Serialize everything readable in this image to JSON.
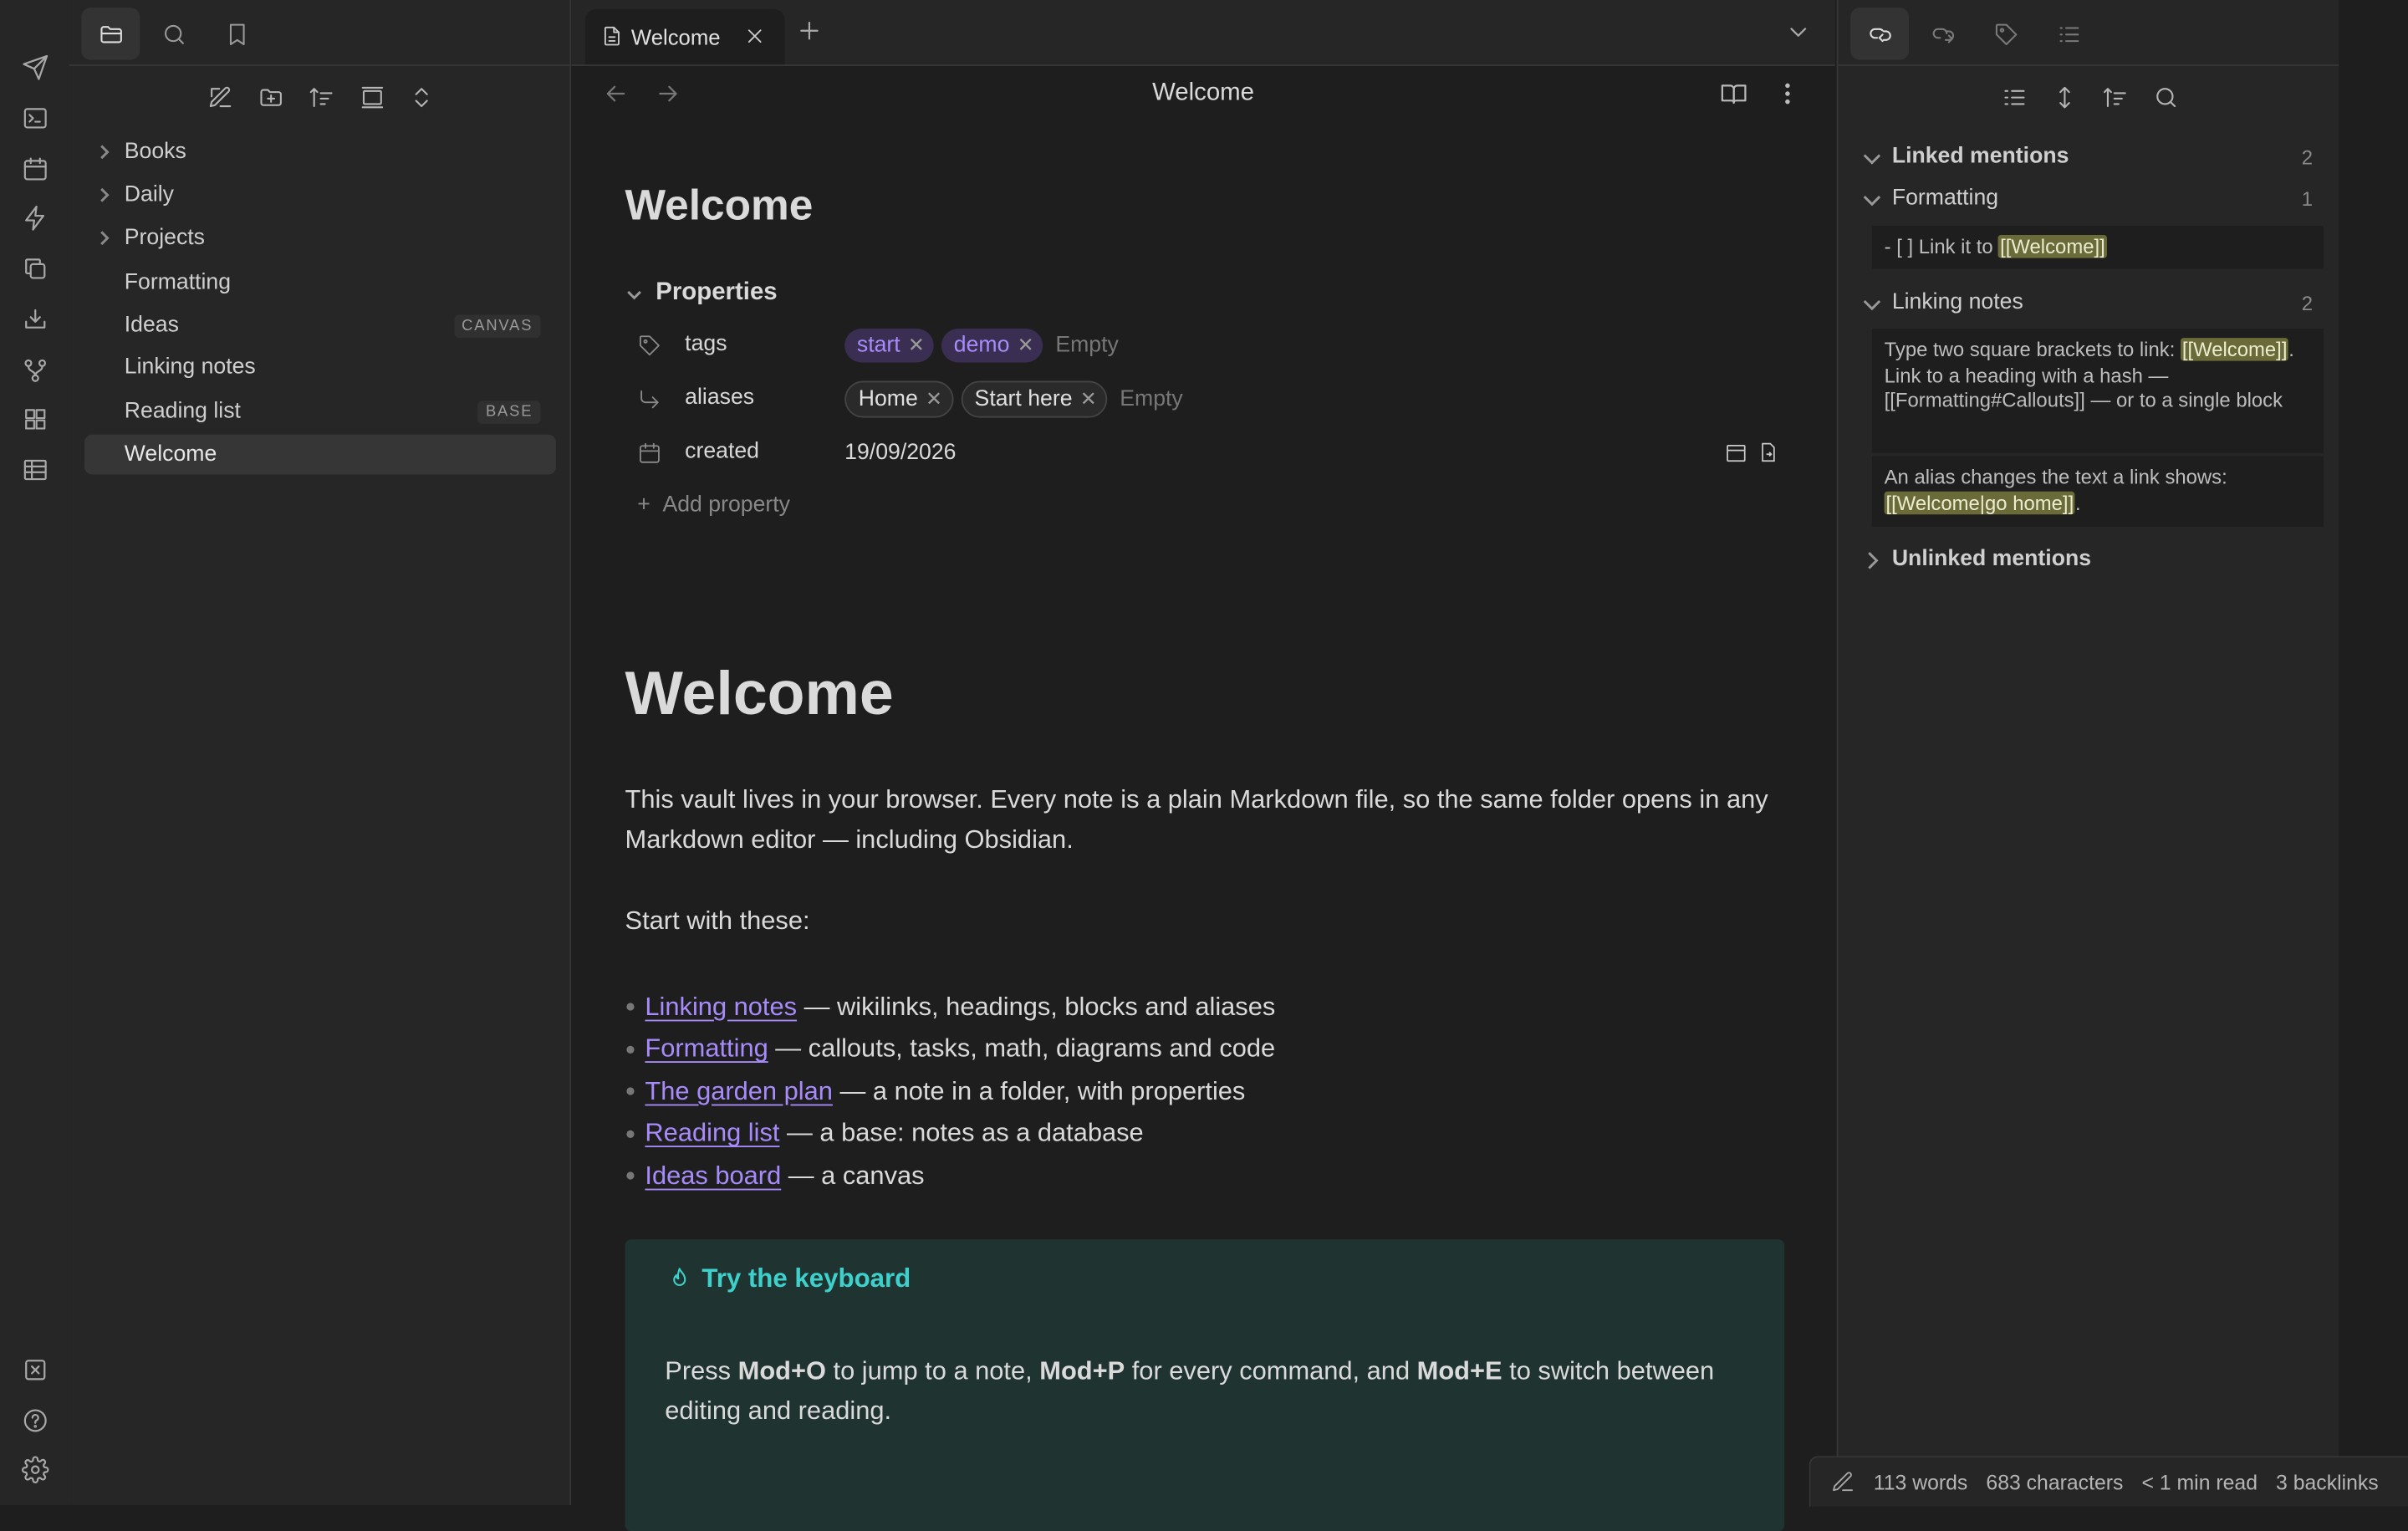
{
  "ribbon": {
    "icons": [
      "send-icon",
      "terminal-icon",
      "calendar-icon",
      "lightning-icon",
      "copy-icon",
      "inbox-download-icon",
      "git-branch-icon",
      "grid-icon",
      "table-icon",
      "close-box-icon",
      "help-icon",
      "settings-icon"
    ]
  },
  "left_sidebar": {
    "tabs": [
      "folder-icon",
      "search-icon",
      "bookmark-icon"
    ],
    "tools": [
      "new-note-icon",
      "new-folder-icon",
      "sort-icon",
      "collapse-all-icon",
      "expand-icon"
    ],
    "tree": [
      {
        "label": "Books",
        "folder": true
      },
      {
        "label": "Daily",
        "folder": true
      },
      {
        "label": "Projects",
        "folder": true
      },
      {
        "label": "Formatting"
      },
      {
        "label": "Ideas",
        "badge": "CANVAS"
      },
      {
        "label": "Linking notes"
      },
      {
        "label": "Reading list",
        "badge": "BASE"
      },
      {
        "label": "Welcome",
        "active": true
      }
    ]
  },
  "tabbar": {
    "tab_title": "Welcome"
  },
  "view": {
    "title": "Welcome"
  },
  "note": {
    "inline_title": "Welcome",
    "properties_label": "Properties",
    "properties": {
      "tags_name": "tags",
      "tags": [
        "start",
        "demo"
      ],
      "aliases_name": "aliases",
      "aliases": [
        "Home",
        "Start here"
      ],
      "empty_label": "Empty",
      "created_name": "created",
      "created_value": "19/09/2026",
      "add_property": "Add property"
    },
    "heading": "Welcome",
    "intro": "This vault lives in your browser. Every note is a plain Markdown file, so the same folder opens in any Markdown editor — including Obsidian.",
    "start_with": "Start with these:",
    "links": [
      {
        "link": "Linking notes",
        "rest": " — wikilinks, headings, blocks and aliases"
      },
      {
        "link": "Formatting",
        "rest": " — callouts, tasks, math, diagrams and code"
      },
      {
        "link": "The garden plan",
        "rest": " — a note in a folder, with properties"
      },
      {
        "link": "Reading list",
        "rest": " — a base: notes as a database"
      },
      {
        "link": "Ideas board",
        "rest": " — a canvas"
      }
    ],
    "callout": {
      "title": "Try the keyboard",
      "text_1": "Press ",
      "key_1": "Mod+O",
      "text_2": " to jump to a note, ",
      "key_2": "Mod+P",
      "text_3": " for every command, and ",
      "key_3": "Mod+E",
      "text_4": " to switch between editing and reading."
    }
  },
  "right_sidebar": {
    "tabs": [
      "backlinks-icon",
      "outgoing-links-icon",
      "tags-icon",
      "outline-icon"
    ],
    "tools": [
      "list-icon",
      "expand-vertical-icon",
      "sort-icon",
      "search-icon"
    ],
    "linked_mentions": "Linked mentions",
    "linked_count": "2",
    "group_1": {
      "name": "Formatting",
      "count": "1",
      "line_prefix": "- [ ] Link it to ",
      "line_link": "[[Welcome]]"
    },
    "group_2": {
      "name": "Linking notes",
      "count": "2",
      "snippet_1_a": "Type two square brackets to link: ",
      "snippet_1_link": "[[Welcome]]",
      "snippet_1_b": ". Link to a heading with a hash — [[Formatting#Callouts]] — or to a single block",
      "snippet_2_a": "An alias changes the text a link shows: ",
      "snippet_2_link": "[[Welcome|go home]]",
      "snippet_2_b": "."
    },
    "unlinked_mentions": "Unlinked mentions"
  },
  "status_bar": {
    "words": "113 words",
    "characters": "683 characters",
    "read_time": "< 1 min read",
    "backlinks": "3 backlinks"
  }
}
